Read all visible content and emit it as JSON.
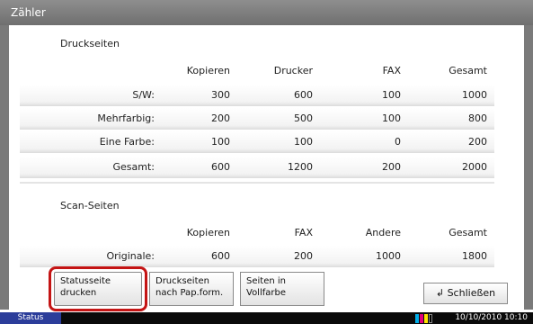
{
  "window": {
    "title": "Zähler"
  },
  "print_section": {
    "heading": "Druckseiten",
    "columns": [
      "Kopieren",
      "Drucker",
      "FAX",
      "Gesamt"
    ],
    "rows": [
      {
        "label": "S/W:",
        "values": [
          "300",
          "600",
          "100",
          "1000"
        ]
      },
      {
        "label": "Mehrfarbig:",
        "values": [
          "200",
          "500",
          "100",
          "800"
        ]
      },
      {
        "label": "Eine Farbe:",
        "values": [
          "100",
          "100",
          "0",
          "200"
        ]
      },
      {
        "label": "Gesamt:",
        "values": [
          "600",
          "1200",
          "200",
          "2000"
        ]
      }
    ]
  },
  "scan_section": {
    "heading": "Scan-Seiten",
    "columns": [
      "Kopieren",
      "FAX",
      "Andere",
      "Gesamt"
    ],
    "rows": [
      {
        "label": "Originale:",
        "values": [
          "600",
          "200",
          "1000",
          "1800"
        ]
      }
    ]
  },
  "buttons": {
    "status_page": "Statusseite\ndrucken",
    "by_paper_format": "Druckseiten\nnach Pap.form.",
    "in_color": "Seiten in\nVollfarbe",
    "close": "Schließen"
  },
  "status_bar": {
    "tab": "Status",
    "datetime": "10/10/2010  10:10"
  },
  "colors": {
    "highlight": "#c41414",
    "status_tab": "#2b3d9a",
    "titlebar": "#7a7a7a"
  },
  "icons": {
    "close": "enter-arrow-icon",
    "toner": "toner-level-icon"
  }
}
